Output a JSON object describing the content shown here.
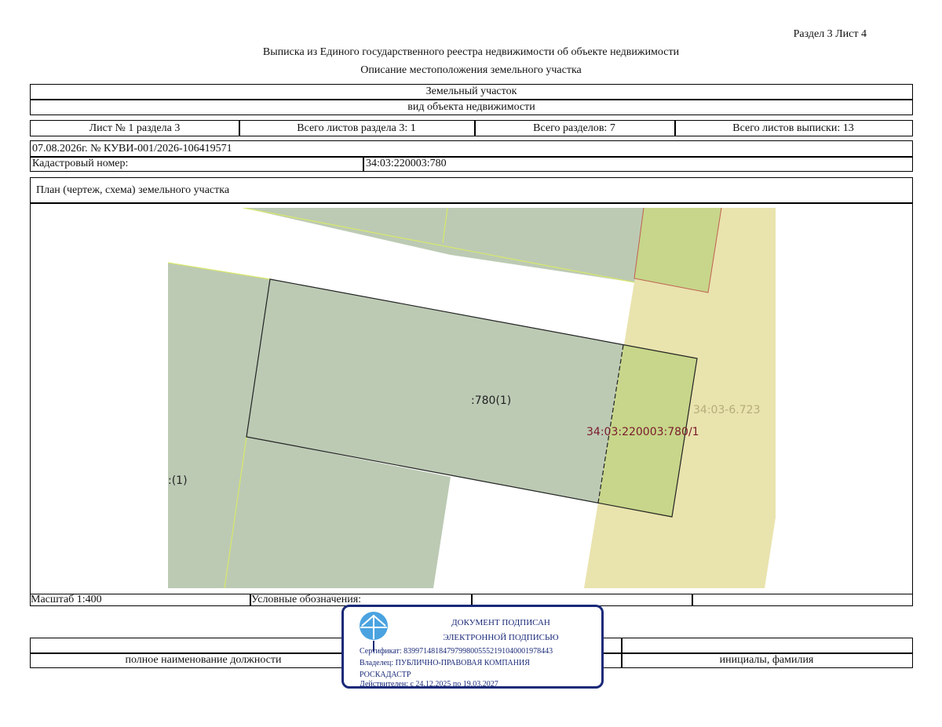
{
  "header": {
    "section_sheet": "Раздел 3    Лист 4",
    "title": "Выписка из Единого государственного реестра недвижимости об объекте недвижимости",
    "subtitle": "Описание местоположения земельного участка"
  },
  "object": {
    "name": "Земельный участок",
    "kind_caption": "вид объекта недвижимости"
  },
  "sheet_info": {
    "sheet_no": "Лист № 1 раздела 3",
    "total_sheets_section": "Всего листов раздела 3: 1",
    "total_sections": "Всего разделов: 7",
    "total_sheets_extract": "Всего листов выписки: 13"
  },
  "extract": {
    "date_number": "07.08.2026г. № КУВИ-001/2026-106419571",
    "cadastral_label": "Кадастровый номер:",
    "cadastral_value": "34:03:220003:780"
  },
  "plan": {
    "title": "План (чертеж, схема) земельного участка",
    "labels": {
      "main_parcel": ":780(1)",
      "sub_parcel": "34:03:220003:780/1",
      "zone": "34:03-6.723",
      "left_partial": ":(1)"
    },
    "colors": {
      "parcel_fill": "#bccab4",
      "sub_fill": "#c7d68a",
      "zone_fill": "#e9e3ae",
      "sub_label": "#7a1a2a",
      "zone_label": "#b5ac7a"
    }
  },
  "footer": {
    "scale": "Масштаб 1:400",
    "legend_label": "Условные обозначения:",
    "position_caption": "полное наименование должности",
    "name_caption": "инициалы, фамилия"
  },
  "stamp": {
    "line1": "ДОКУМЕНТ ПОДПИСАН",
    "line2": "ЭЛЕКТРОННОЙ ПОДПИСЬЮ",
    "certificate": "Сертификат: 839971481847979980055521910400019784​43",
    "owner": "Владелец: ПУБЛИЧНО-ПРАВОВАЯ КОМПАНИЯ",
    "owner2": "РОСКАДАСТР",
    "valid": "Действителен: с 24.12.2025 по 19.03.2027",
    "color": "#1a2a78"
  }
}
